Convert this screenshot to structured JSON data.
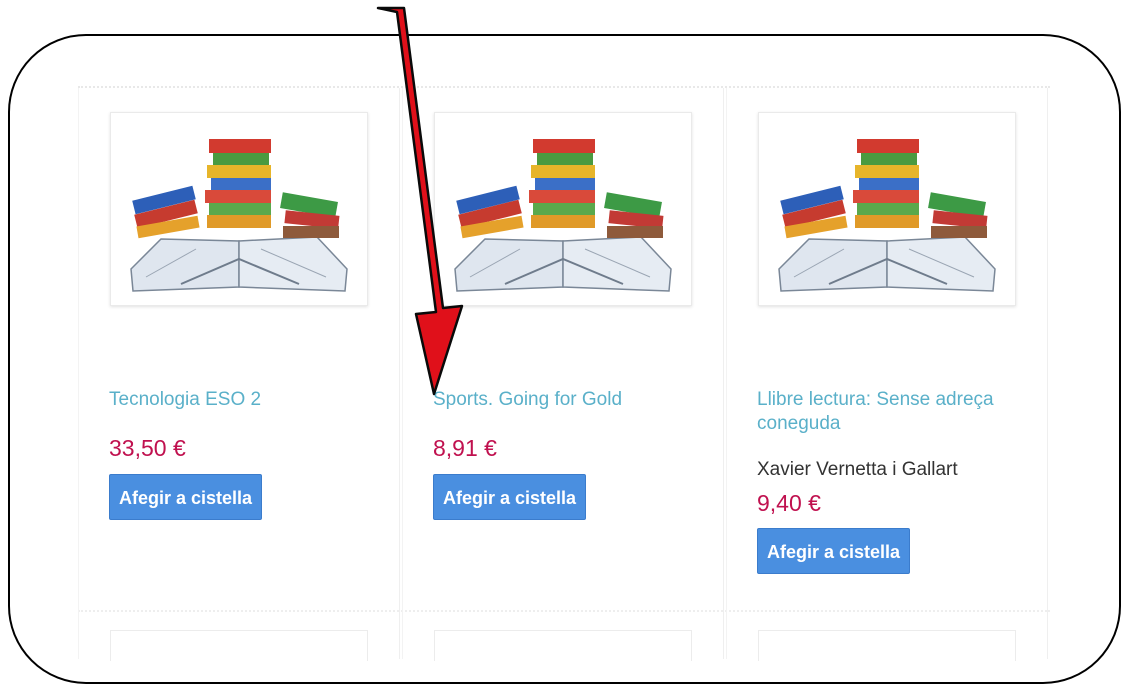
{
  "products": [
    {
      "title": "Tecnologia ESO 2",
      "author": "",
      "price": "33,50 €",
      "button": "Afegir a cistella"
    },
    {
      "title": "Sports. Going for Gold",
      "author": "",
      "price": "8,91 €",
      "button": "Afegir a cistella"
    },
    {
      "title": "Llibre lectura: Sense adreça coneguda",
      "author": "Xavier Vernetta i Gallart",
      "price": "9,40 €",
      "button": "Afegir a cistella"
    }
  ],
  "colors": {
    "title": "#5ab0c9",
    "price": "#c0114f",
    "button": "#4a8fe0",
    "arrow": "#e0101a"
  },
  "icons": {
    "product_image": "books-stack-illustration",
    "annotation": "red-arrow-pointer"
  }
}
